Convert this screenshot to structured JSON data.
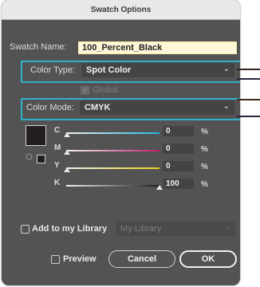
{
  "dialog": {
    "title": "Swatch Options"
  },
  "swatch_name": {
    "label": "Swatch Name:",
    "value": "100_Percent_Black"
  },
  "color_type": {
    "label": "Color Type:",
    "value": "Spot Color"
  },
  "global": {
    "label": "Global",
    "checked": true,
    "disabled": true
  },
  "color_mode": {
    "label": "Color Mode:",
    "value": "CMYK"
  },
  "channels": [
    {
      "label": "C",
      "value": "0",
      "unit": "%",
      "fraction": 0
    },
    {
      "label": "M",
      "value": "0",
      "unit": "%",
      "fraction": 0
    },
    {
      "label": "Y",
      "value": "0",
      "unit": "%",
      "fraction": 0
    },
    {
      "label": "K",
      "value": "100",
      "unit": "%",
      "fraction": 1
    }
  ],
  "library": {
    "label": "Add to my Library",
    "select_value": "My Library",
    "checked": false
  },
  "preview": {
    "label": "Preview",
    "checked": false
  },
  "buttons": {
    "cancel": "Cancel",
    "ok": "OK"
  },
  "colors": {
    "highlight": "#2fb1c9",
    "dialog_bg": "#535353",
    "swatch": "#231f20"
  }
}
